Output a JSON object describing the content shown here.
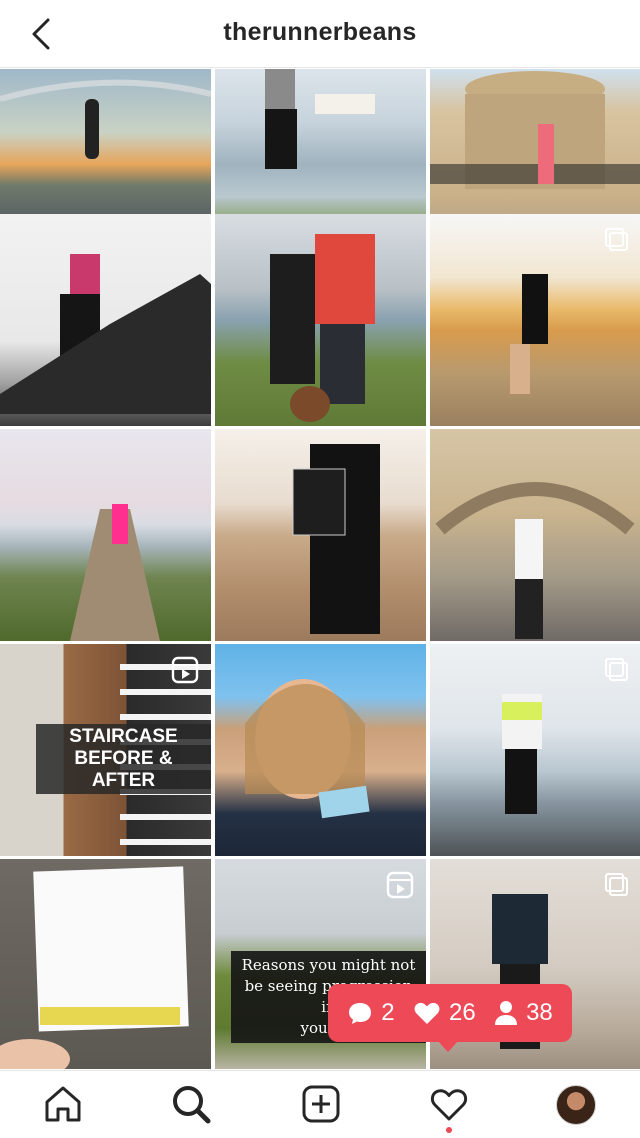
{
  "header": {
    "title": "therunnerbeans"
  },
  "tiles": {
    "t10": {
      "overlay": "STAIRCASE\nBEFORE & AFTER"
    },
    "t13": {
      "overlay": "Reasons you might not\nbe seeing progression in\nyour ru"
    }
  },
  "notification": {
    "comments": "2",
    "likes": "26",
    "follows": "38"
  },
  "icons": {
    "back": "chevron-left-icon",
    "reel": "reel-icon",
    "carousel": "carousel-icon",
    "home": "home-icon",
    "search": "search-icon",
    "add": "plus-square-icon",
    "activity": "heart-icon"
  },
  "colors": {
    "accent": "#ed4956",
    "text": "#262626"
  }
}
